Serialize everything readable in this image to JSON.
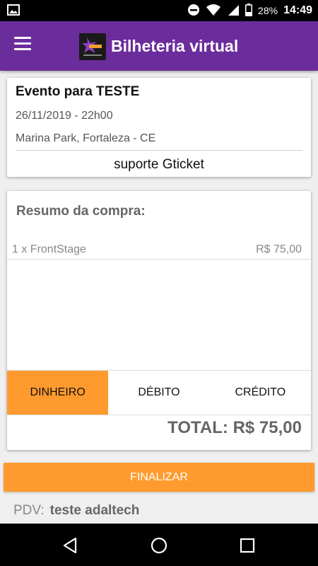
{
  "status_bar": {
    "battery": "28%",
    "time": "14:49"
  },
  "app_bar": {
    "title": "Bilheteria virtual"
  },
  "event": {
    "name": "Evento para TESTE",
    "date": "26/11/2019 - 22h00",
    "place": "Marina Park, Fortaleza - CE",
    "support": "suporte Gticket"
  },
  "summary": {
    "title": "Resumo da compra:",
    "items": [
      {
        "description": "1 x FrontStage",
        "price": "R$ 75,00"
      }
    ],
    "payment_options": [
      {
        "label": "DINHEIRO",
        "selected": true
      },
      {
        "label": "DÉBITO",
        "selected": false
      },
      {
        "label": "CRÉDITO",
        "selected": false
      }
    ],
    "total": "TOTAL: R$ 75,00"
  },
  "finish_button": "FINALIZAR",
  "pdv": {
    "label": "PDV:",
    "value": "teste adaltech"
  },
  "colors": {
    "app_bar": "#6b2c9c",
    "accent": "#ff9a2e"
  },
  "icons": [
    "image-icon",
    "do-not-disturb-icon",
    "wifi-icon",
    "signal-icon",
    "battery-icon",
    "menu-icon",
    "back-icon",
    "home-icon",
    "recent-apps-icon"
  ]
}
